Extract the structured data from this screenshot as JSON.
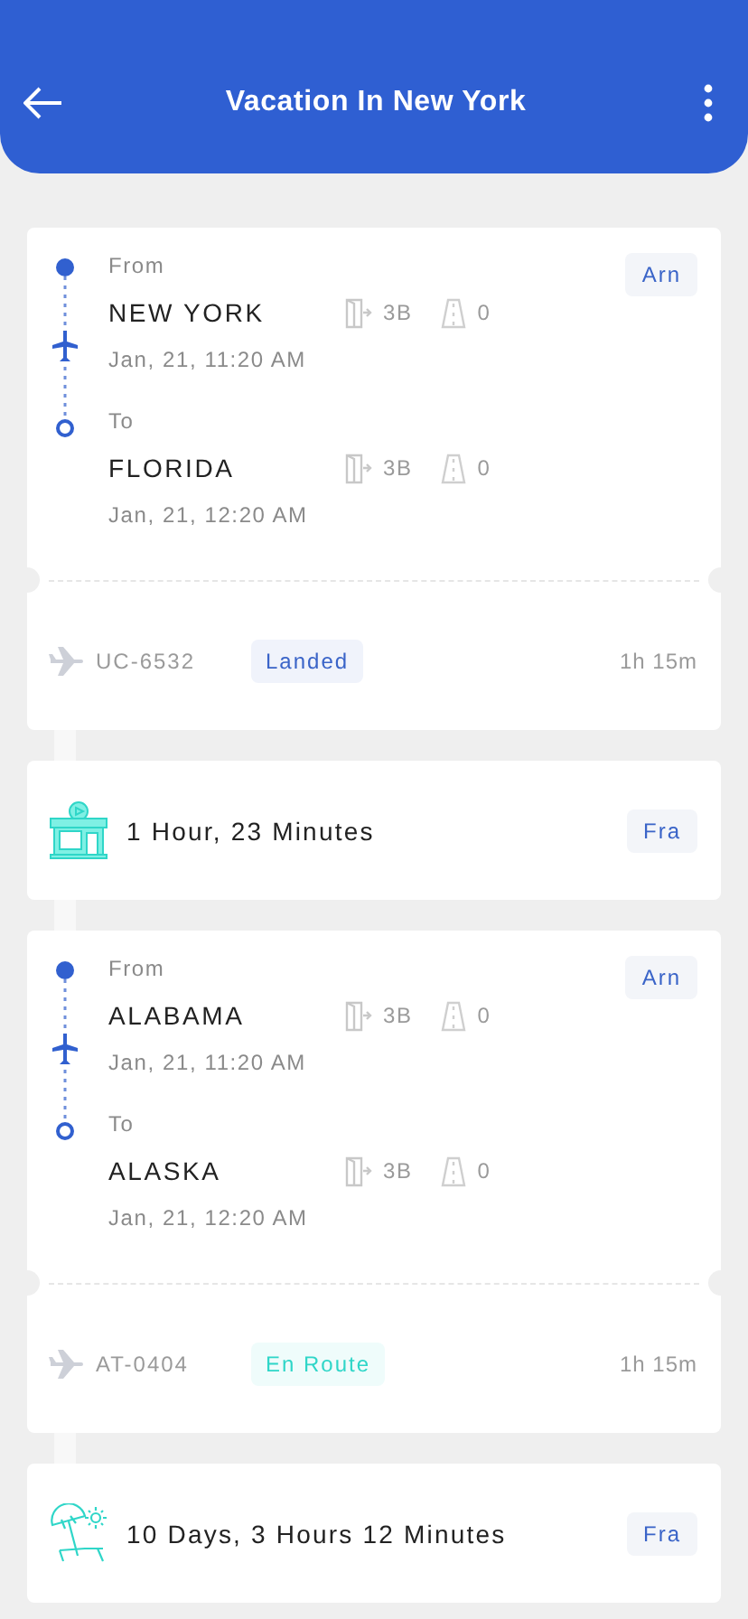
{
  "header": {
    "title": "Vacation In New York"
  },
  "items": [
    {
      "kind": "flight",
      "badge": "Arn",
      "stops": [
        {
          "label": "From",
          "city": "NEW YORK",
          "gate": "3B",
          "runway": "0",
          "time": "Jan, 21, 11:20 AM"
        },
        {
          "label": "To",
          "city": "FLORIDA",
          "gate": "3B",
          "runway": "0",
          "time": "Jan, 21, 12:20 AM"
        }
      ],
      "flight_no": "UC-6532",
      "status": {
        "text": "Landed",
        "color": "#3a64c8"
      },
      "duration": "1h 15m"
    },
    {
      "kind": "layover",
      "text": "1 Hour, 23 Minutes",
      "badge": "Fra"
    },
    {
      "kind": "flight",
      "badge": "Arn",
      "stops": [
        {
          "label": "From",
          "city": "ALABAMA",
          "gate": "3B",
          "runway": "0",
          "time": "Jan, 21, 11:20 AM"
        },
        {
          "label": "To",
          "city": "ALASKA",
          "gate": "3B",
          "runway": "0",
          "time": "Jan, 21, 12:20 AM"
        }
      ],
      "flight_no": "AT-0404",
      "status": {
        "text": "En Route",
        "color": "#2fd6c8"
      },
      "duration": "1h 15m"
    },
    {
      "kind": "vacation",
      "text": "10 Days, 3 Hours 12 Minutes",
      "badge": "Fra"
    }
  ]
}
